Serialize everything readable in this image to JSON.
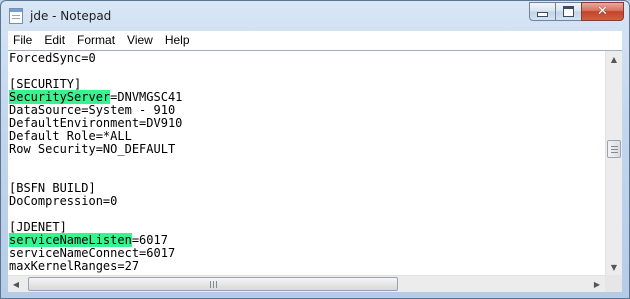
{
  "window": {
    "title": "jde - Notepad"
  },
  "caption_buttons": {
    "minimize": "minimize-icon",
    "maximize": "maximize-icon",
    "close_glyph": "✕"
  },
  "menu": [
    "File",
    "Edit",
    "Format",
    "View",
    "Help"
  ],
  "highlight_color": "#36f58e",
  "lines": [
    {
      "text": "ForcedSync=0"
    },
    {
      "text": ""
    },
    {
      "text": "[SECURITY]"
    },
    {
      "hl": "SecurityServer",
      "text": "=DNVMGSC41"
    },
    {
      "text": "DataSource=System - 910"
    },
    {
      "text": "DefaultEnvironment=DV910"
    },
    {
      "text": "Default Role=*ALL"
    },
    {
      "text": "Row Security=NO_DEFAULT"
    },
    {
      "text": ""
    },
    {
      "text": ""
    },
    {
      "text": "[BSFN BUILD]"
    },
    {
      "text": "DoCompression=0"
    },
    {
      "text": ""
    },
    {
      "text": "[JDENET]"
    },
    {
      "hl": "serviceNameListen",
      "text": "=6017"
    },
    {
      "text": "serviceNameConnect=6017"
    },
    {
      "text": "maxKernelRanges=27"
    }
  ],
  "scroll": {
    "vertical_position": 0.42,
    "horizontal_position": 0.0,
    "up_glyph": "▲",
    "down_glyph": "▼",
    "left_glyph": "◀",
    "right_glyph": "▶"
  }
}
